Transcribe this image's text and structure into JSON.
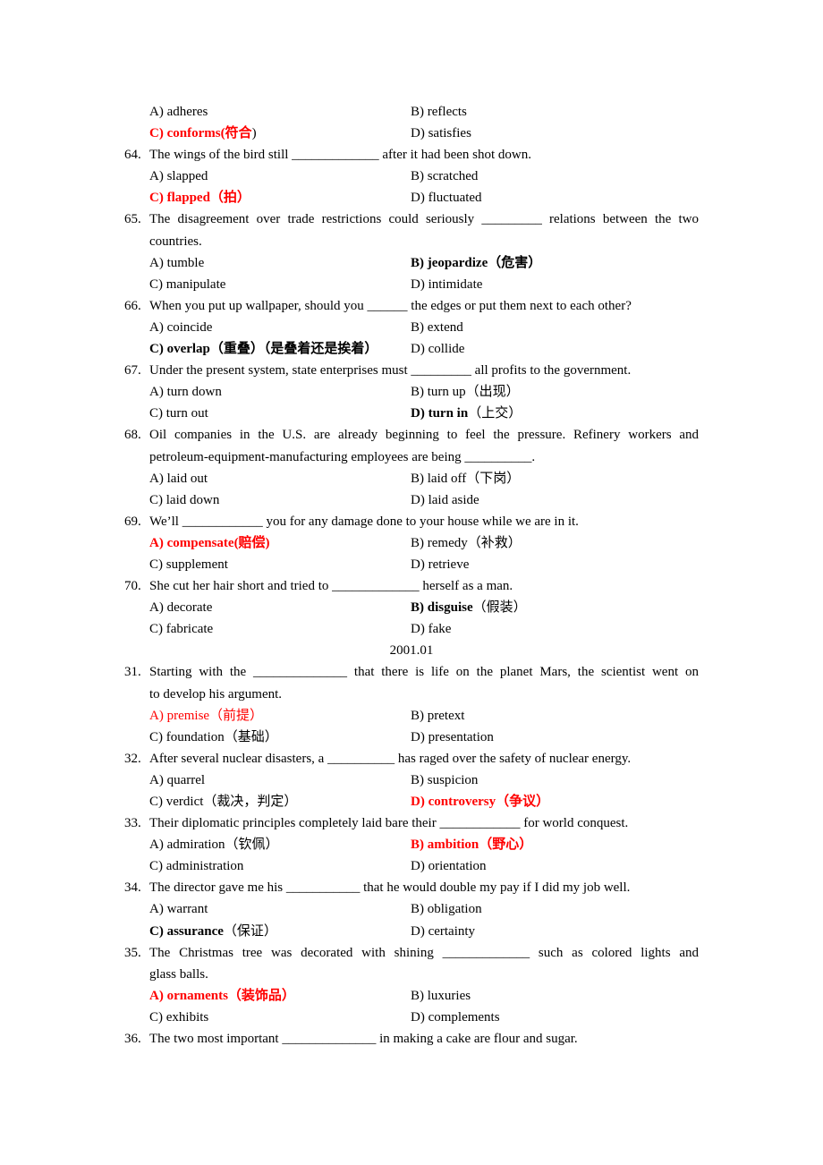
{
  "lines": [
    {
      "type": "options",
      "left": {
        "label": "A) adheres",
        "style": ""
      },
      "right": {
        "label": "B) reflects",
        "style": ""
      }
    },
    {
      "type": "options",
      "left": {
        "label": "C) conforms(符合",
        "suffix": ")",
        "style": "red bold"
      },
      "right": {
        "label": "D) satisfies",
        "style": ""
      }
    },
    {
      "type": "question",
      "num": "64.",
      "text": "The wings of the bird still _____________ after it had been shot down."
    },
    {
      "type": "options",
      "left": {
        "label": "A) slapped",
        "style": ""
      },
      "right": {
        "label": "B) scratched",
        "style": ""
      }
    },
    {
      "type": "options",
      "left": {
        "label": "C) flapped（拍）",
        "style": "red bold"
      },
      "right": {
        "label": "D) fluctuated",
        "style": ""
      }
    },
    {
      "type": "question",
      "num": "65.",
      "text": "The disagreement over trade restrictions could seriously _________ relations between the two",
      "justify": true
    },
    {
      "type": "cont",
      "text": "countries."
    },
    {
      "type": "options",
      "left": {
        "label": "A) tumble",
        "style": ""
      },
      "right": {
        "label": "B) jeopardize（危害）",
        "style": "bold"
      }
    },
    {
      "type": "options",
      "left": {
        "label": "C) manipulate",
        "style": ""
      },
      "right": {
        "label": "D) intimidate",
        "style": ""
      }
    },
    {
      "type": "question",
      "num": "66.",
      "text": "When you put up wallpaper, should you ______ the edges or put them next to each other?"
    },
    {
      "type": "options",
      "left": {
        "label": "A) coincide",
        "style": ""
      },
      "right": {
        "label": "B) extend",
        "style": ""
      }
    },
    {
      "type": "options",
      "left": {
        "label": "C) overlap（重叠）（是叠着还是挨着）",
        "style": "bold"
      },
      "right": {
        "label": "D) collide",
        "style": ""
      }
    },
    {
      "type": "question",
      "num": "67.",
      "text": "Under the present system, state enterprises must _________ all profits to the government."
    },
    {
      "type": "options",
      "left": {
        "label": "A) turn down",
        "style": ""
      },
      "right": {
        "label": "B) turn up（出现）",
        "style": ""
      }
    },
    {
      "type": "options",
      "left": {
        "label": "C) turn out",
        "style": ""
      },
      "right": {
        "label": "D) turn in",
        "suffix": "（上交）",
        "style": "bold"
      }
    },
    {
      "type": "question",
      "num": "68.",
      "text": "Oil companies in the U.S. are already beginning to feel the pressure. Refinery workers and",
      "justify": true
    },
    {
      "type": "cont",
      "text": "petroleum-equipment-manufacturing employees are being __________."
    },
    {
      "type": "options",
      "left": {
        "label": "A) laid out",
        "style": ""
      },
      "right": {
        "label": "B) laid off（下岗）",
        "style": ""
      }
    },
    {
      "type": "options",
      "left": {
        "label": "C) laid down",
        "style": ""
      },
      "right": {
        "label": "D) laid aside",
        "style": ""
      }
    },
    {
      "type": "question",
      "num": "69.",
      "text": "We’ll ____________ you for any damage done to your house while we are in it."
    },
    {
      "type": "options",
      "left": {
        "label": "A) compensate(赔偿)",
        "style": "red bold"
      },
      "right": {
        "label": "B) remedy（补救）",
        "style": ""
      }
    },
    {
      "type": "options",
      "left": {
        "label": "C) supplement",
        "style": ""
      },
      "right": {
        "label": "D) retrieve",
        "style": ""
      }
    },
    {
      "type": "question",
      "num": "70.",
      "text": "She cut her hair short and tried to _____________ herself as a man."
    },
    {
      "type": "options",
      "left": {
        "label": "A) decorate",
        "style": ""
      },
      "right": {
        "label": "B) disguise",
        "suffix": "（假装）",
        "style": "bold"
      }
    },
    {
      "type": "options",
      "left": {
        "label": "C) fabricate",
        "style": ""
      },
      "right": {
        "label": "D) fake",
        "style": ""
      }
    },
    {
      "type": "heading",
      "text": "2001.01"
    },
    {
      "type": "question",
      "num": "31.",
      "text": "Starting with the ______________ that there is life on the planet Mars, the scientist went on",
      "justify": true
    },
    {
      "type": "cont",
      "text": "to develop his argument."
    },
    {
      "type": "options",
      "left": {
        "label": "A) premise（前提）",
        "style": "red"
      },
      "right": {
        "label": "B) pretext",
        "style": ""
      }
    },
    {
      "type": "options",
      "left": {
        "label": "C) foundation（基础）",
        "style": ""
      },
      "right": {
        "label": "D) presentation",
        "style": ""
      }
    },
    {
      "type": "question",
      "num": "32.",
      "text": "After several nuclear disasters, a __________ has raged over the safety of nuclear energy."
    },
    {
      "type": "options",
      "left": {
        "label": "A) quarrel",
        "style": ""
      },
      "right": {
        "label": "B) suspicion",
        "style": ""
      }
    },
    {
      "type": "options",
      "left": {
        "label": "C) verdict（裁决，判定）",
        "style": ""
      },
      "right": {
        "label": "D) controversy（争议）",
        "style": "red bold"
      }
    },
    {
      "type": "question",
      "num": "33.",
      "text": "Their diplomatic principles completely laid bare their ____________ for world conquest."
    },
    {
      "type": "options",
      "left": {
        "label": "A) admiration（钦佩）",
        "style": ""
      },
      "right": {
        "label": "B) ambition（野心）",
        "style": "red bold"
      }
    },
    {
      "type": "options",
      "left": {
        "label": "C) administration",
        "style": ""
      },
      "right": {
        "label": "D) orientation",
        "style": ""
      }
    },
    {
      "type": "question",
      "num": "34.",
      "text": "The director gave me his ___________ that he would double my pay if I did my job well."
    },
    {
      "type": "options",
      "left": {
        "label": "A) warrant",
        "style": ""
      },
      "right": {
        "label": "B) obligation",
        "style": ""
      }
    },
    {
      "type": "options",
      "left": {
        "label": "C) assurance",
        "suffix": "（保证）",
        "style": "bold"
      },
      "right": {
        "label": "D) certainty",
        "style": ""
      }
    },
    {
      "type": "question",
      "num": "35.",
      "text": "The Christmas tree was decorated with shining _____________ such as colored lights and",
      "justify": true
    },
    {
      "type": "cont",
      "text": "glass balls."
    },
    {
      "type": "options",
      "left": {
        "label": "A) ornaments（装饰品）",
        "style": "red bold"
      },
      "right": {
        "label": "B) luxuries",
        "style": ""
      }
    },
    {
      "type": "options",
      "left": {
        "label": "C) exhibits",
        "style": ""
      },
      "right": {
        "label": "D) complements",
        "style": ""
      }
    },
    {
      "type": "question",
      "num": "36.",
      "text": "The two most important ______________ in making a cake are flour and sugar."
    }
  ]
}
